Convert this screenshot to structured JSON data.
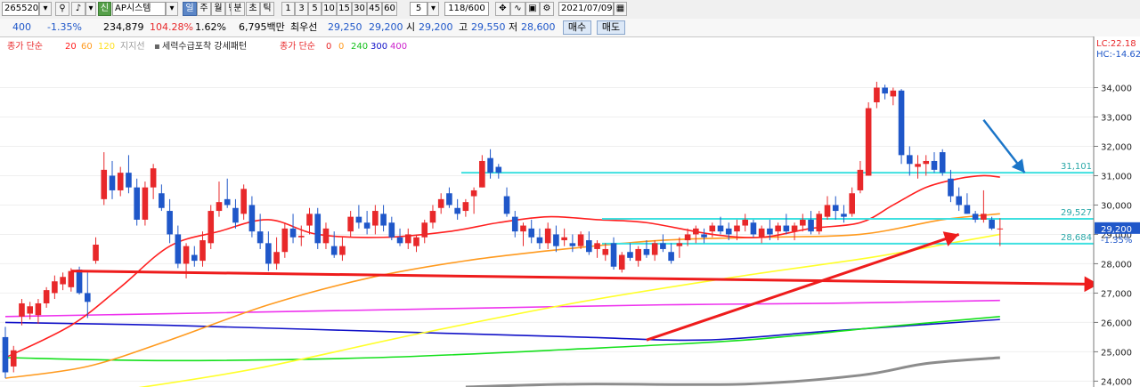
{
  "toolbar": {
    "code": "265520",
    "shin": "신",
    "name": "AP시스템",
    "periods": [
      "일",
      "주",
      "월",
      "년",
      "분",
      "초",
      "틱"
    ],
    "minutes": [
      "1",
      "3",
      "5",
      "10",
      "15",
      "30",
      "45",
      "60"
    ],
    "count": "5",
    "range": "118/600",
    "date": "2021/07/09"
  },
  "quote": {
    "change": "400",
    "change_pct": "-1.35%",
    "volume": "234,879",
    "vol_ratio": "104.28%",
    "turnover": "1.62%",
    "amount": "6,795백만",
    "best_bid_label": "최우선",
    "ask": "29,250",
    "bid": "29,200",
    "open_label": "시",
    "open": "29,200",
    "high_label": "고",
    "high": "29,550",
    "low_label": "저",
    "low": "28,600",
    "buy_label": "매수",
    "sell_label": "매도"
  },
  "legend": {
    "ma_label": "종가 단순",
    "ma_periods": [
      "20",
      "60",
      "120"
    ],
    "support_label": "지지선",
    "pattern_label": "세력수급포착 강세패턴",
    "ma2_label": "종가 단순",
    "ma2_periods": [
      "0",
      "0",
      "240",
      "300",
      "400"
    ]
  },
  "colors": {
    "up": "#e8282a",
    "down": "#1f57c9",
    "ma20": "#ff1f1f",
    "ma60": "#ff9a1e",
    "ma120": "#ffff2a",
    "ma240": "#14e01c",
    "ma300": "#1111c8",
    "ma400": "#ee33ee",
    "support_line": "#3fe0e0",
    "trend_arrow": "#ee1c1c",
    "note_arrow": "#1b75c8",
    "grey_line": "#8c8c8c"
  },
  "chart_data": {
    "type": "candlestick",
    "ylim": [
      23800,
      35500
    ],
    "y_ticks": [
      24000,
      25000,
      26000,
      27000,
      28000,
      29000,
      30000,
      31000,
      32000,
      33000,
      34000
    ],
    "y_tick_labels": [
      "24,000",
      "25,000",
      "26,000",
      "27,000",
      "28,000",
      "29,000",
      "30,000",
      "31,000",
      "32,000",
      "33,000",
      "34,000"
    ],
    "corner_labels": [
      "LC:22.18",
      "HC:-14.62"
    ],
    "price_tag": "29,200",
    "price_tag_pct": "-1.35%",
    "levels": [
      {
        "value": 31101,
        "label": "31,101"
      },
      {
        "value": 29527,
        "label": "29,527"
      },
      {
        "value": 28684,
        "label": "28,684"
      }
    ],
    "candles": [
      {
        "o": 25500,
        "h": 25850,
        "l": 24100,
        "c": 24300
      },
      {
        "o": 24500,
        "h": 25200,
        "l": 24300,
        "c": 25050
      },
      {
        "o": 26200,
        "h": 26800,
        "l": 25900,
        "c": 26650
      },
      {
        "o": 26300,
        "h": 26700,
        "l": 26100,
        "c": 26550
      },
      {
        "o": 26250,
        "h": 26800,
        "l": 25950,
        "c": 26650
      },
      {
        "o": 26650,
        "h": 27200,
        "l": 26500,
        "c": 27100
      },
      {
        "o": 27000,
        "h": 27600,
        "l": 26800,
        "c": 27400
      },
      {
        "o": 27300,
        "h": 27700,
        "l": 27100,
        "c": 27550
      },
      {
        "o": 27200,
        "h": 27850,
        "l": 27050,
        "c": 27750
      },
      {
        "o": 27800,
        "h": 27900,
        "l": 26950,
        "c": 27000
      },
      {
        "o": 27000,
        "h": 27700,
        "l": 26150,
        "c": 26700
      },
      {
        "o": 28100,
        "h": 28900,
        "l": 28000,
        "c": 28650
      },
      {
        "o": 30200,
        "h": 31800,
        "l": 30000,
        "c": 31200
      },
      {
        "o": 31000,
        "h": 31500,
        "l": 30200,
        "c": 30500
      },
      {
        "o": 30500,
        "h": 31300,
        "l": 30300,
        "c": 31100
      },
      {
        "o": 31100,
        "h": 31700,
        "l": 30400,
        "c": 30600
      },
      {
        "o": 30600,
        "h": 30900,
        "l": 29300,
        "c": 29500
      },
      {
        "o": 29500,
        "h": 30800,
        "l": 29300,
        "c": 30600
      },
      {
        "o": 30600,
        "h": 31400,
        "l": 30200,
        "c": 31250
      },
      {
        "o": 30400,
        "h": 30700,
        "l": 29800,
        "c": 29900
      },
      {
        "o": 29800,
        "h": 30200,
        "l": 28700,
        "c": 29000
      },
      {
        "o": 29000,
        "h": 29300,
        "l": 27850,
        "c": 28000
      },
      {
        "o": 28000,
        "h": 28700,
        "l": 27500,
        "c": 28600
      },
      {
        "o": 28300,
        "h": 28600,
        "l": 27900,
        "c": 28100
      },
      {
        "o": 28100,
        "h": 29100,
        "l": 27900,
        "c": 28800
      },
      {
        "o": 28700,
        "h": 30000,
        "l": 28500,
        "c": 29800
      },
      {
        "o": 29800,
        "h": 30800,
        "l": 29600,
        "c": 30100
      },
      {
        "o": 30200,
        "h": 30900,
        "l": 29900,
        "c": 30000
      },
      {
        "o": 29900,
        "h": 30200,
        "l": 29200,
        "c": 29400
      },
      {
        "o": 29700,
        "h": 30700,
        "l": 29500,
        "c": 30550
      },
      {
        "o": 30000,
        "h": 30300,
        "l": 28900,
        "c": 29100
      },
      {
        "o": 29100,
        "h": 29700,
        "l": 28500,
        "c": 28700
      },
      {
        "o": 28700,
        "h": 29100,
        "l": 27750,
        "c": 28000
      },
      {
        "o": 28000,
        "h": 28900,
        "l": 27800,
        "c": 28400
      },
      {
        "o": 28400,
        "h": 29400,
        "l": 28200,
        "c": 29200
      },
      {
        "o": 29200,
        "h": 29700,
        "l": 28700,
        "c": 28900
      },
      {
        "o": 28900,
        "h": 29300,
        "l": 28600,
        "c": 28950
      },
      {
        "o": 29300,
        "h": 29900,
        "l": 29000,
        "c": 29700
      },
      {
        "o": 29700,
        "h": 29900,
        "l": 28500,
        "c": 28700
      },
      {
        "o": 28700,
        "h": 29400,
        "l": 28500,
        "c": 29200
      },
      {
        "o": 28600,
        "h": 29100,
        "l": 28200,
        "c": 28300
      },
      {
        "o": 28300,
        "h": 28900,
        "l": 28100,
        "c": 28600
      },
      {
        "o": 29100,
        "h": 29800,
        "l": 28900,
        "c": 29600
      },
      {
        "o": 29600,
        "h": 30000,
        "l": 29200,
        "c": 29400
      },
      {
        "o": 29400,
        "h": 29800,
        "l": 29000,
        "c": 29200
      },
      {
        "o": 29300,
        "h": 30000,
        "l": 29000,
        "c": 29800
      },
      {
        "o": 29700,
        "h": 30000,
        "l": 29100,
        "c": 29300
      },
      {
        "o": 29400,
        "h": 29600,
        "l": 28800,
        "c": 28900
      },
      {
        "o": 28900,
        "h": 29200,
        "l": 28600,
        "c": 28700
      },
      {
        "o": 28700,
        "h": 29200,
        "l": 28500,
        "c": 29000
      },
      {
        "o": 28600,
        "h": 29000,
        "l": 28400,
        "c": 28900
      },
      {
        "o": 28900,
        "h": 29500,
        "l": 28700,
        "c": 29400
      },
      {
        "o": 29400,
        "h": 30000,
        "l": 29200,
        "c": 29800
      },
      {
        "o": 29900,
        "h": 30400,
        "l": 29700,
        "c": 30200
      },
      {
        "o": 30400,
        "h": 30600,
        "l": 29900,
        "c": 30000
      },
      {
        "o": 29900,
        "h": 30200,
        "l": 29500,
        "c": 29700
      },
      {
        "o": 29800,
        "h": 30200,
        "l": 29600,
        "c": 30100
      },
      {
        "o": 30300,
        "h": 30600,
        "l": 29700,
        "c": 30500
      },
      {
        "o": 30600,
        "h": 31700,
        "l": 30600,
        "c": 31500
      },
      {
        "o": 31600,
        "h": 31900,
        "l": 30900,
        "c": 31100
      },
      {
        "o": 31300,
        "h": 31400,
        "l": 30900,
        "c": 31100
      },
      {
        "o": 30300,
        "h": 30600,
        "l": 29600,
        "c": 29700
      },
      {
        "o": 29600,
        "h": 29800,
        "l": 28900,
        "c": 29100
      },
      {
        "o": 29100,
        "h": 29400,
        "l": 28600,
        "c": 29300
      },
      {
        "o": 29200,
        "h": 29500,
        "l": 28700,
        "c": 28900
      },
      {
        "o": 28900,
        "h": 29200,
        "l": 28500,
        "c": 28700
      },
      {
        "o": 28700,
        "h": 29400,
        "l": 28500,
        "c": 29200
      },
      {
        "o": 29000,
        "h": 29300,
        "l": 28400,
        "c": 28600
      },
      {
        "o": 28800,
        "h": 29200,
        "l": 28600,
        "c": 28900
      },
      {
        "o": 28700,
        "h": 29000,
        "l": 28400,
        "c": 28600
      },
      {
        "o": 28600,
        "h": 29100,
        "l": 28500,
        "c": 29000
      },
      {
        "o": 28800,
        "h": 29100,
        "l": 28300,
        "c": 28400
      },
      {
        "o": 28500,
        "h": 28800,
        "l": 28200,
        "c": 28700
      },
      {
        "o": 28300,
        "h": 28700,
        "l": 28100,
        "c": 28500
      },
      {
        "o": 28700,
        "h": 28900,
        "l": 27800,
        "c": 27900
      },
      {
        "o": 27800,
        "h": 28400,
        "l": 27700,
        "c": 28300
      },
      {
        "o": 28400,
        "h": 28700,
        "l": 28100,
        "c": 28200
      },
      {
        "o": 28100,
        "h": 28600,
        "l": 27900,
        "c": 28500
      },
      {
        "o": 28500,
        "h": 28800,
        "l": 28200,
        "c": 28300
      },
      {
        "o": 28300,
        "h": 28800,
        "l": 28100,
        "c": 28700
      },
      {
        "o": 28700,
        "h": 29000,
        "l": 28400,
        "c": 28500
      },
      {
        "o": 28400,
        "h": 28700,
        "l": 28000,
        "c": 28100
      },
      {
        "o": 28600,
        "h": 28900,
        "l": 28200,
        "c": 28700
      },
      {
        "o": 28800,
        "h": 29200,
        "l": 28600,
        "c": 29000
      },
      {
        "o": 29000,
        "h": 29300,
        "l": 28700,
        "c": 29200
      },
      {
        "o": 29000,
        "h": 29200,
        "l": 28700,
        "c": 28900
      },
      {
        "o": 29100,
        "h": 29400,
        "l": 28900,
        "c": 29300
      },
      {
        "o": 29300,
        "h": 29600,
        "l": 29000,
        "c": 29100
      },
      {
        "o": 29200,
        "h": 29400,
        "l": 28800,
        "c": 29000
      },
      {
        "o": 29100,
        "h": 29500,
        "l": 28800,
        "c": 29300
      },
      {
        "o": 29300,
        "h": 29700,
        "l": 29100,
        "c": 29500
      },
      {
        "o": 29400,
        "h": 29500,
        "l": 28900,
        "c": 29000
      },
      {
        "o": 28900,
        "h": 29300,
        "l": 28700,
        "c": 29200
      },
      {
        "o": 29200,
        "h": 29500,
        "l": 28800,
        "c": 29000
      },
      {
        "o": 29100,
        "h": 29400,
        "l": 28800,
        "c": 29300
      },
      {
        "o": 29300,
        "h": 29700,
        "l": 29000,
        "c": 29100
      },
      {
        "o": 29100,
        "h": 29400,
        "l": 28800,
        "c": 29300
      },
      {
        "o": 29300,
        "h": 29700,
        "l": 29100,
        "c": 29500
      },
      {
        "o": 29500,
        "h": 29800,
        "l": 29000,
        "c": 29100
      },
      {
        "o": 29100,
        "h": 29800,
        "l": 29000,
        "c": 29700
      },
      {
        "o": 29600,
        "h": 30300,
        "l": 29500,
        "c": 30000
      },
      {
        "o": 30000,
        "h": 30300,
        "l": 29500,
        "c": 29800
      },
      {
        "o": 29700,
        "h": 30000,
        "l": 29400,
        "c": 29600
      },
      {
        "o": 29700,
        "h": 30600,
        "l": 29600,
        "c": 30400
      },
      {
        "o": 30500,
        "h": 31500,
        "l": 30400,
        "c": 31200
      },
      {
        "o": 31000,
        "h": 33500,
        "l": 31000,
        "c": 33300
      },
      {
        "o": 33500,
        "h": 34200,
        "l": 33300,
        "c": 34000
      },
      {
        "o": 34000,
        "h": 34100,
        "l": 33600,
        "c": 33800
      },
      {
        "o": 33700,
        "h": 34000,
        "l": 33400,
        "c": 33900
      },
      {
        "o": 33900,
        "h": 33950,
        "l": 31400,
        "c": 31700
      },
      {
        "o": 31700,
        "h": 32000,
        "l": 31000,
        "c": 31400
      },
      {
        "o": 31300,
        "h": 31700,
        "l": 30900,
        "c": 31400
      },
      {
        "o": 31400,
        "h": 31700,
        "l": 31000,
        "c": 31500
      },
      {
        "o": 31500,
        "h": 31800,
        "l": 31100,
        "c": 31200
      },
      {
        "o": 31800,
        "h": 31900,
        "l": 31000,
        "c": 31100
      },
      {
        "o": 30900,
        "h": 31200,
        "l": 30100,
        "c": 30300
      },
      {
        "o": 30300,
        "h": 30600,
        "l": 29800,
        "c": 30000
      },
      {
        "o": 30000,
        "h": 30400,
        "l": 29700,
        "c": 29700
      },
      {
        "o": 29700,
        "h": 29800,
        "l": 29400,
        "c": 29500
      },
      {
        "o": 29500,
        "h": 30500,
        "l": 29400,
        "c": 29700
      },
      {
        "o": 29500,
        "h": 29600,
        "l": 29150,
        "c": 29200
      },
      {
        "o": 29200,
        "h": 29550,
        "l": 28600,
        "c": 29200
      }
    ],
    "ma20": [
      [
        0,
        24800
      ],
      [
        8,
        25900
      ],
      [
        14,
        27200
      ],
      [
        20,
        28600
      ],
      [
        26,
        29100
      ],
      [
        32,
        29500
      ],
      [
        38,
        29000
      ],
      [
        46,
        28900
      ],
      [
        54,
        29100
      ],
      [
        60,
        29400
      ],
      [
        66,
        29600
      ],
      [
        72,
        29500
      ],
      [
        78,
        29400
      ],
      [
        86,
        29000
      ],
      [
        92,
        28900
      ],
      [
        98,
        29200
      ],
      [
        104,
        29400
      ],
      [
        108,
        30000
      ],
      [
        112,
        30600
      ],
      [
        116,
        30900
      ],
      [
        119,
        31000
      ],
      [
        121,
        30950
      ]
    ],
    "ma60": [
      [
        0,
        24100
      ],
      [
        10,
        24500
      ],
      [
        20,
        25400
      ],
      [
        32,
        26600
      ],
      [
        44,
        27500
      ],
      [
        56,
        28100
      ],
      [
        68,
        28500
      ],
      [
        80,
        28800
      ],
      [
        92,
        28900
      ],
      [
        104,
        29000
      ],
      [
        114,
        29500
      ],
      [
        121,
        29700
      ]
    ],
    "ma120": [
      [
        12,
        23600
      ],
      [
        30,
        24400
      ],
      [
        50,
        25600
      ],
      [
        70,
        26700
      ],
      [
        90,
        27600
      ],
      [
        105,
        28200
      ],
      [
        115,
        28700
      ],
      [
        121,
        29000
      ]
    ],
    "ma240": [
      [
        0,
        24800
      ],
      [
        20,
        24700
      ],
      [
        45,
        24800
      ],
      [
        70,
        25100
      ],
      [
        90,
        25400
      ],
      [
        105,
        25800
      ],
      [
        121,
        26200
      ]
    ],
    "ma300": [
      [
        0,
        26000
      ],
      [
        20,
        25900
      ],
      [
        45,
        25700
      ],
      [
        70,
        25500
      ],
      [
        85,
        25400
      ],
      [
        100,
        25700
      ],
      [
        121,
        26100
      ]
    ],
    "ma400": [
      [
        0,
        26200
      ],
      [
        20,
        26300
      ],
      [
        40,
        26400
      ],
      [
        60,
        26500
      ],
      [
        80,
        26600
      ],
      [
        100,
        26650
      ],
      [
        121,
        26750
      ]
    ],
    "grey": [
      [
        56,
        23800
      ],
      [
        70,
        23900
      ],
      [
        90,
        23900
      ],
      [
        104,
        24200
      ],
      [
        112,
        24600
      ],
      [
        121,
        24800
      ]
    ],
    "trend_line": {
      "from": [
        8,
        27750
      ],
      "to": [
        133,
        27300
      ]
    },
    "rise_arrow": {
      "from": [
        78,
        25400
      ],
      "to": [
        116,
        29000
      ]
    },
    "note_arrow": {
      "from": [
        119,
        32900
      ],
      "to": [
        124,
        31100
      ]
    }
  }
}
